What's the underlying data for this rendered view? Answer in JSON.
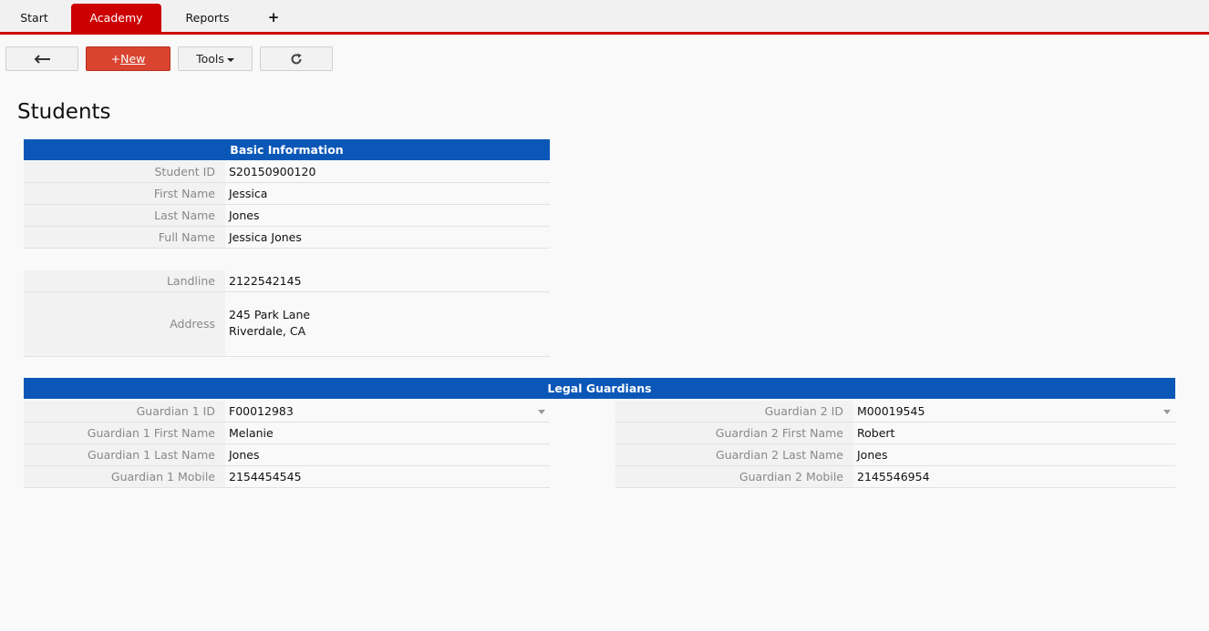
{
  "tabs": [
    {
      "label": "Start"
    },
    {
      "label": "Academy"
    },
    {
      "label": "Reports"
    },
    {
      "label": "+"
    }
  ],
  "toolbar": {
    "new_prefix": "+",
    "new_label": "New",
    "tools_label": "Tools"
  },
  "page_title": "Students",
  "basic_info": {
    "title": "Basic Information",
    "fields": [
      {
        "label": "Student ID",
        "value": "S20150900120"
      },
      {
        "label": "First Name",
        "value": "Jessica"
      },
      {
        "label": "Last Name",
        "value": "Jones"
      },
      {
        "label": "Full Name",
        "value": "Jessica Jones"
      },
      {
        "label": "Landline",
        "value": "2122542145"
      }
    ],
    "address": {
      "label": "Address",
      "line1": "245 Park Lane",
      "line2": "Riverdale, CA"
    }
  },
  "guardians": {
    "title": "Legal Guardians",
    "g1": [
      {
        "label": "Guardian 1 ID",
        "value": "F00012983"
      },
      {
        "label": "Guardian 1 First Name",
        "value": "Melanie"
      },
      {
        "label": "Guardian 1 Last Name",
        "value": "Jones"
      },
      {
        "label": "Guardian 1 Mobile",
        "value": "2154454545"
      }
    ],
    "g2": [
      {
        "label": "Guardian 2 ID",
        "value": "M00019545"
      },
      {
        "label": "Guardian 2 First Name",
        "value": "Robert"
      },
      {
        "label": "Guardian 2 Last Name",
        "value": "Jones"
      },
      {
        "label": "Guardian 2 Mobile",
        "value": "2145546954"
      }
    ]
  },
  "colors": {
    "accent": "#cc0000",
    "section_header": "#0a57b8",
    "new_button": "#d9432f",
    "link": "#2b74c6"
  },
  "icons": {
    "back": "arrow-left-icon",
    "refresh": "refresh-icon",
    "tools_caret": "caret-down-icon",
    "dropdown": "chevron-down-icon"
  }
}
